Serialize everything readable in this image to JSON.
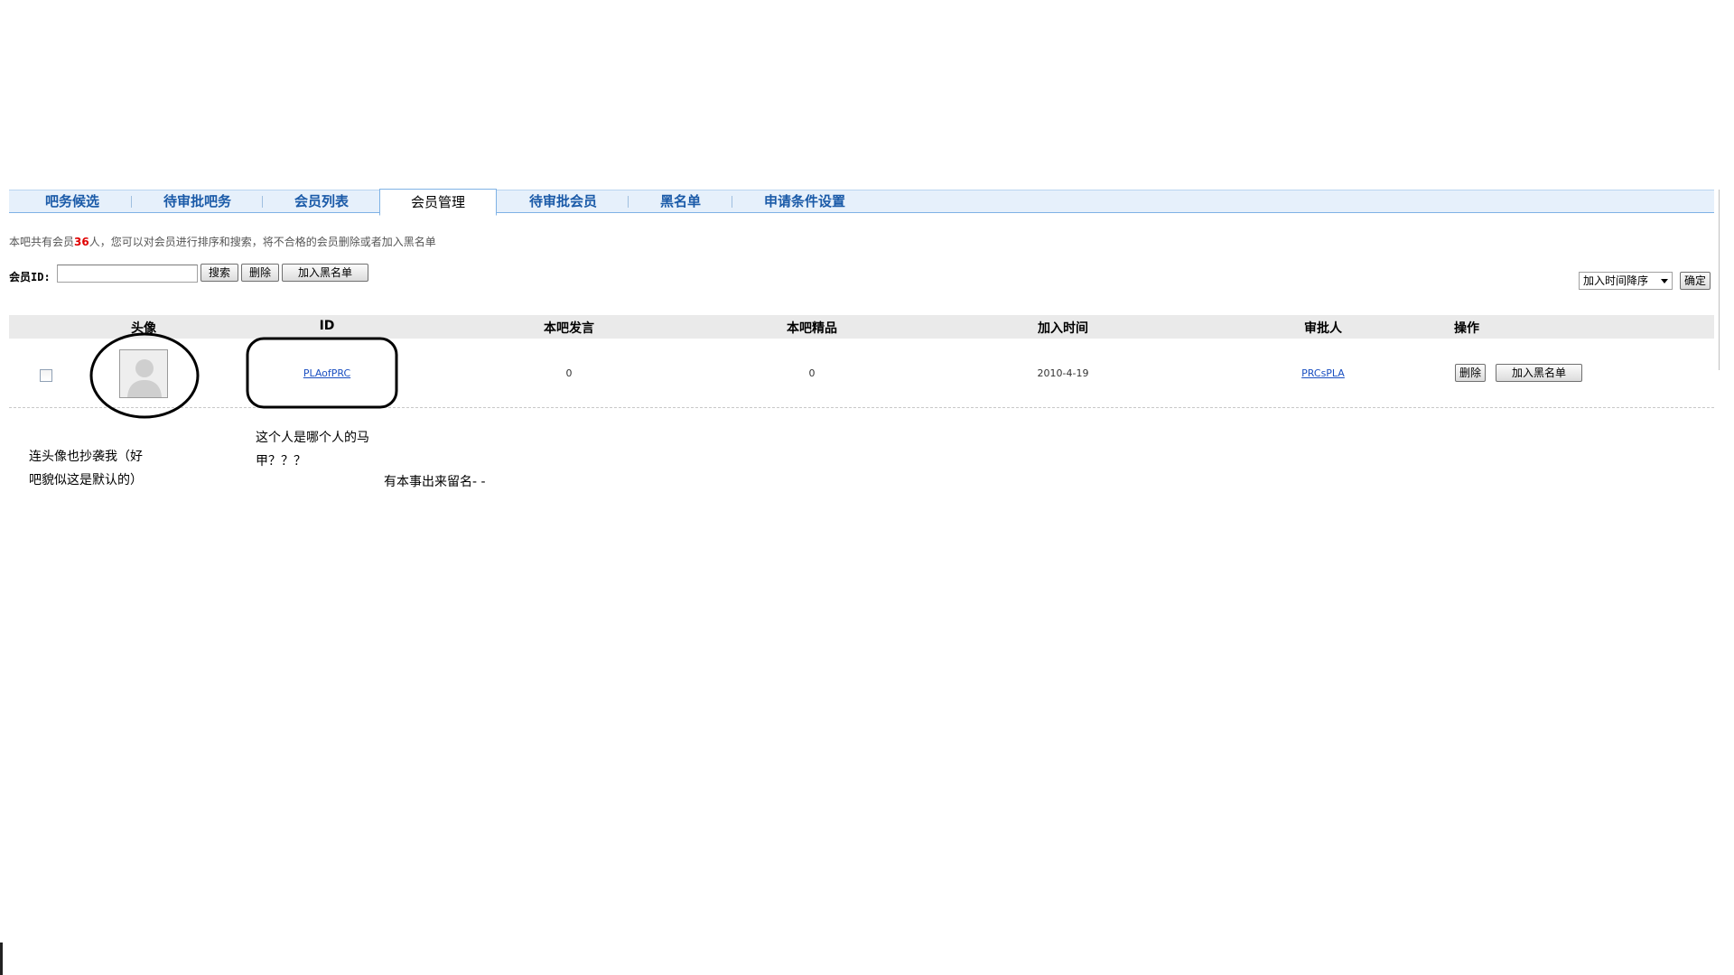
{
  "tabs": [
    {
      "label": "吧务候选"
    },
    {
      "label": "待审批吧务"
    },
    {
      "label": "会员列表"
    },
    {
      "label": "会员管理",
      "active": true
    },
    {
      "label": "待审批会员"
    },
    {
      "label": "黑名单"
    },
    {
      "label": "申请条件设置"
    }
  ],
  "info": {
    "prefix": "本吧共有会员",
    "count": "36",
    "suffix": "人，您可以对会员进行排序和搜索，将不合格的会员删除或者加入黑名单"
  },
  "search": {
    "label": "会员ID:",
    "value": "",
    "search_button": "搜索",
    "delete_button": "删除",
    "blacklist_button": "加入黑名单"
  },
  "sort": {
    "selected": "加入时间降序",
    "confirm_button": "确定"
  },
  "table": {
    "headers": [
      "头像",
      "ID",
      "本吧发言",
      "本吧精品",
      "加入时间",
      "审批人",
      "操作"
    ],
    "rows": [
      {
        "id": "PLAofPRC",
        "posts": "0",
        "featured": "0",
        "join_time": "2010-4-19",
        "approver": "PRCsPLA",
        "delete_button": "删除",
        "blacklist_button": "加入黑名单"
      }
    ]
  },
  "annotations": {
    "avatar_note_line1": "连头像也抄袭我（好",
    "avatar_note_line2": "吧貌似这是默认的）",
    "id_note_line1": "这个人是哪个人的马",
    "id_note_line2": "甲？？？",
    "challenge_note": "有本事出来留名- -"
  },
  "icons": {
    "avatar": "default-avatar-silhouette-icon",
    "dropdown": "chevron-down-icon"
  },
  "colors": {
    "tab_bar_bg": "#e6f0fb",
    "tab_text": "#1a5aa8",
    "link": "#1a4fc1",
    "count_highlight": "#e00000"
  }
}
